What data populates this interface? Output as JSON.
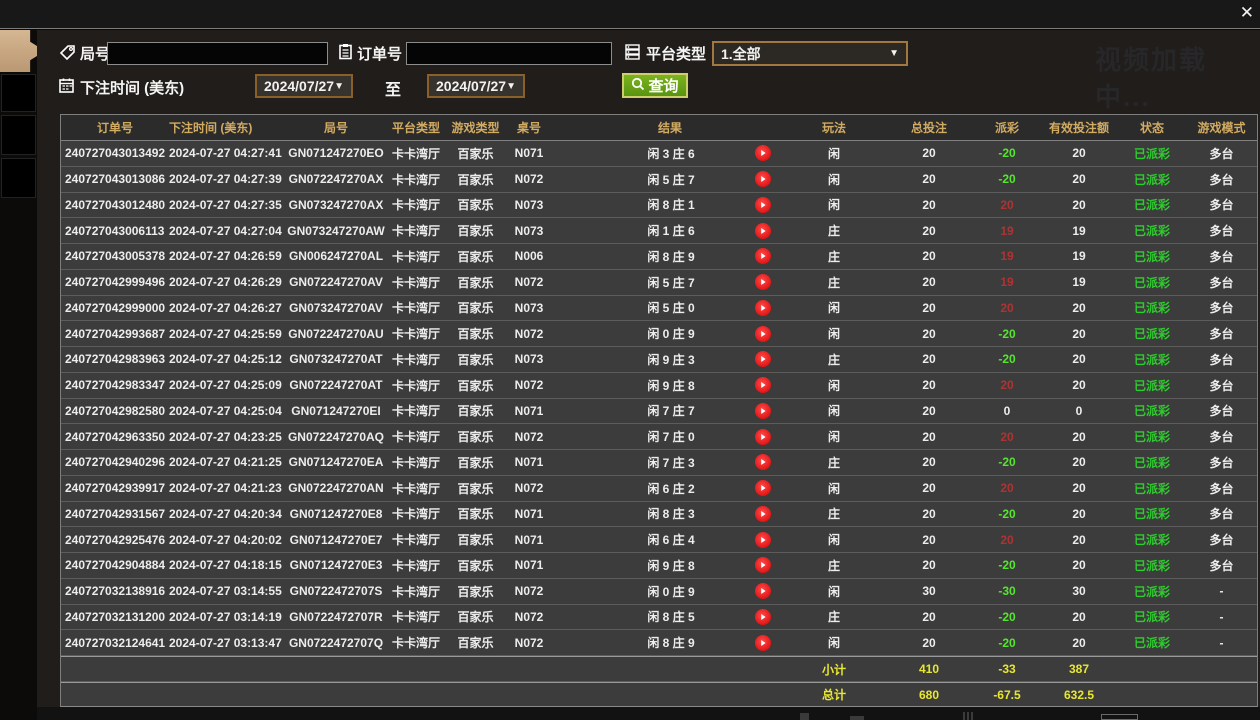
{
  "window": {
    "close_label": "✕",
    "watermark": "视频加载中..."
  },
  "filters": {
    "round_label": "局号",
    "round_value": "",
    "order_label": "订单号",
    "order_value": "",
    "platform_label": "平台类型",
    "platform_value": "1.全部",
    "bet_time_label": "下注时间 (美东)",
    "date_from": "2024/07/27",
    "to_label": "至",
    "date_to": "2024/07/27",
    "query_label": "查询",
    "dropdown_arrow": "▼"
  },
  "table": {
    "columns": [
      "订单号",
      "下注时间 (美东)",
      "局号",
      "平台类型",
      "游戏类型",
      "桌号",
      "结果",
      "玩法",
      "总投注",
      "派彩",
      "有效投注额",
      "状态",
      "游戏模式"
    ],
    "rows": [
      [
        "240727043013492",
        "2024-07-27 04:27:41",
        "GN071247270EO",
        "卡卡湾厅",
        "百家乐",
        "N071",
        "闲 3 庄 6",
        "闲",
        "20",
        "-20",
        "20",
        "已派彩",
        "多台"
      ],
      [
        "240727043013086",
        "2024-07-27 04:27:39",
        "GN072247270AX",
        "卡卡湾厅",
        "百家乐",
        "N072",
        "闲 5 庄 7",
        "闲",
        "20",
        "-20",
        "20",
        "已派彩",
        "多台"
      ],
      [
        "240727043012480",
        "2024-07-27 04:27:35",
        "GN073247270AX",
        "卡卡湾厅",
        "百家乐",
        "N073",
        "闲 8 庄 1",
        "闲",
        "20",
        "20",
        "20",
        "已派彩",
        "多台"
      ],
      [
        "240727043006113",
        "2024-07-27 04:27:04",
        "GN073247270AW",
        "卡卡湾厅",
        "百家乐",
        "N073",
        "闲 1 庄 6",
        "庄",
        "20",
        "19",
        "19",
        "已派彩",
        "多台"
      ],
      [
        "240727043005378",
        "2024-07-27 04:26:59",
        "GN006247270AL",
        "卡卡湾厅",
        "百家乐",
        "N006",
        "闲 8 庄 9",
        "庄",
        "20",
        "19",
        "19",
        "已派彩",
        "多台"
      ],
      [
        "240727042999496",
        "2024-07-27 04:26:29",
        "GN072247270AV",
        "卡卡湾厅",
        "百家乐",
        "N072",
        "闲 5 庄 7",
        "庄",
        "20",
        "19",
        "19",
        "已派彩",
        "多台"
      ],
      [
        "240727042999000",
        "2024-07-27 04:26:27",
        "GN073247270AV",
        "卡卡湾厅",
        "百家乐",
        "N073",
        "闲 5 庄 0",
        "闲",
        "20",
        "20",
        "20",
        "已派彩",
        "多台"
      ],
      [
        "240727042993687",
        "2024-07-27 04:25:59",
        "GN072247270AU",
        "卡卡湾厅",
        "百家乐",
        "N072",
        "闲 0 庄 9",
        "闲",
        "20",
        "-20",
        "20",
        "已派彩",
        "多台"
      ],
      [
        "240727042983963",
        "2024-07-27 04:25:12",
        "GN073247270AT",
        "卡卡湾厅",
        "百家乐",
        "N073",
        "闲 9 庄 3",
        "庄",
        "20",
        "-20",
        "20",
        "已派彩",
        "多台"
      ],
      [
        "240727042983347",
        "2024-07-27 04:25:09",
        "GN072247270AT",
        "卡卡湾厅",
        "百家乐",
        "N072",
        "闲 9 庄 8",
        "闲",
        "20",
        "20",
        "20",
        "已派彩",
        "多台"
      ],
      [
        "240727042982580",
        "2024-07-27 04:25:04",
        "GN071247270EI",
        "卡卡湾厅",
        "百家乐",
        "N071",
        "闲 7 庄 7",
        "闲",
        "20",
        "0",
        "0",
        "已派彩",
        "多台"
      ],
      [
        "240727042963350",
        "2024-07-27 04:23:25",
        "GN072247270AQ",
        "卡卡湾厅",
        "百家乐",
        "N072",
        "闲 7 庄 0",
        "闲",
        "20",
        "20",
        "20",
        "已派彩",
        "多台"
      ],
      [
        "240727042940296",
        "2024-07-27 04:21:25",
        "GN071247270EA",
        "卡卡湾厅",
        "百家乐",
        "N071",
        "闲 7 庄 3",
        "庄",
        "20",
        "-20",
        "20",
        "已派彩",
        "多台"
      ],
      [
        "240727042939917",
        "2024-07-27 04:21:23",
        "GN072247270AN",
        "卡卡湾厅",
        "百家乐",
        "N072",
        "闲 6 庄 2",
        "闲",
        "20",
        "20",
        "20",
        "已派彩",
        "多台"
      ],
      [
        "240727042931567",
        "2024-07-27 04:20:34",
        "GN071247270E8",
        "卡卡湾厅",
        "百家乐",
        "N071",
        "闲 8 庄 3",
        "庄",
        "20",
        "-20",
        "20",
        "已派彩",
        "多台"
      ],
      [
        "240727042925476",
        "2024-07-27 04:20:02",
        "GN071247270E7",
        "卡卡湾厅",
        "百家乐",
        "N071",
        "闲 6 庄 4",
        "闲",
        "20",
        "20",
        "20",
        "已派彩",
        "多台"
      ],
      [
        "240727042904884",
        "2024-07-27 04:18:15",
        "GN071247270E3",
        "卡卡湾厅",
        "百家乐",
        "N071",
        "闲 9 庄 8",
        "庄",
        "20",
        "-20",
        "20",
        "已派彩",
        "多台"
      ],
      [
        "240727032138916",
        "2024-07-27 03:14:55",
        "GN0722472707S",
        "卡卡湾厅",
        "百家乐",
        "N072",
        "闲 0 庄 9",
        "闲",
        "30",
        "-30",
        "30",
        "已派彩",
        "-"
      ],
      [
        "240727032131200",
        "2024-07-27 03:14:19",
        "GN0722472707R",
        "卡卡湾厅",
        "百家乐",
        "N072",
        "闲 8 庄 5",
        "庄",
        "20",
        "-20",
        "20",
        "已派彩",
        "-"
      ],
      [
        "240727032124641",
        "2024-07-27 03:13:47",
        "GN0722472707Q",
        "卡卡湾厅",
        "百家乐",
        "N072",
        "闲 8 庄 9",
        "闲",
        "20",
        "-20",
        "20",
        "已派彩",
        "-"
      ]
    ]
  },
  "footer": {
    "subtotal_label": "小计",
    "subtotal_bet": "410",
    "subtotal_payout": "-33",
    "subtotal_valid": "387",
    "total_label": "总计",
    "total_bet": "680",
    "total_payout": "-67.5",
    "total_valid": "632.5"
  }
}
